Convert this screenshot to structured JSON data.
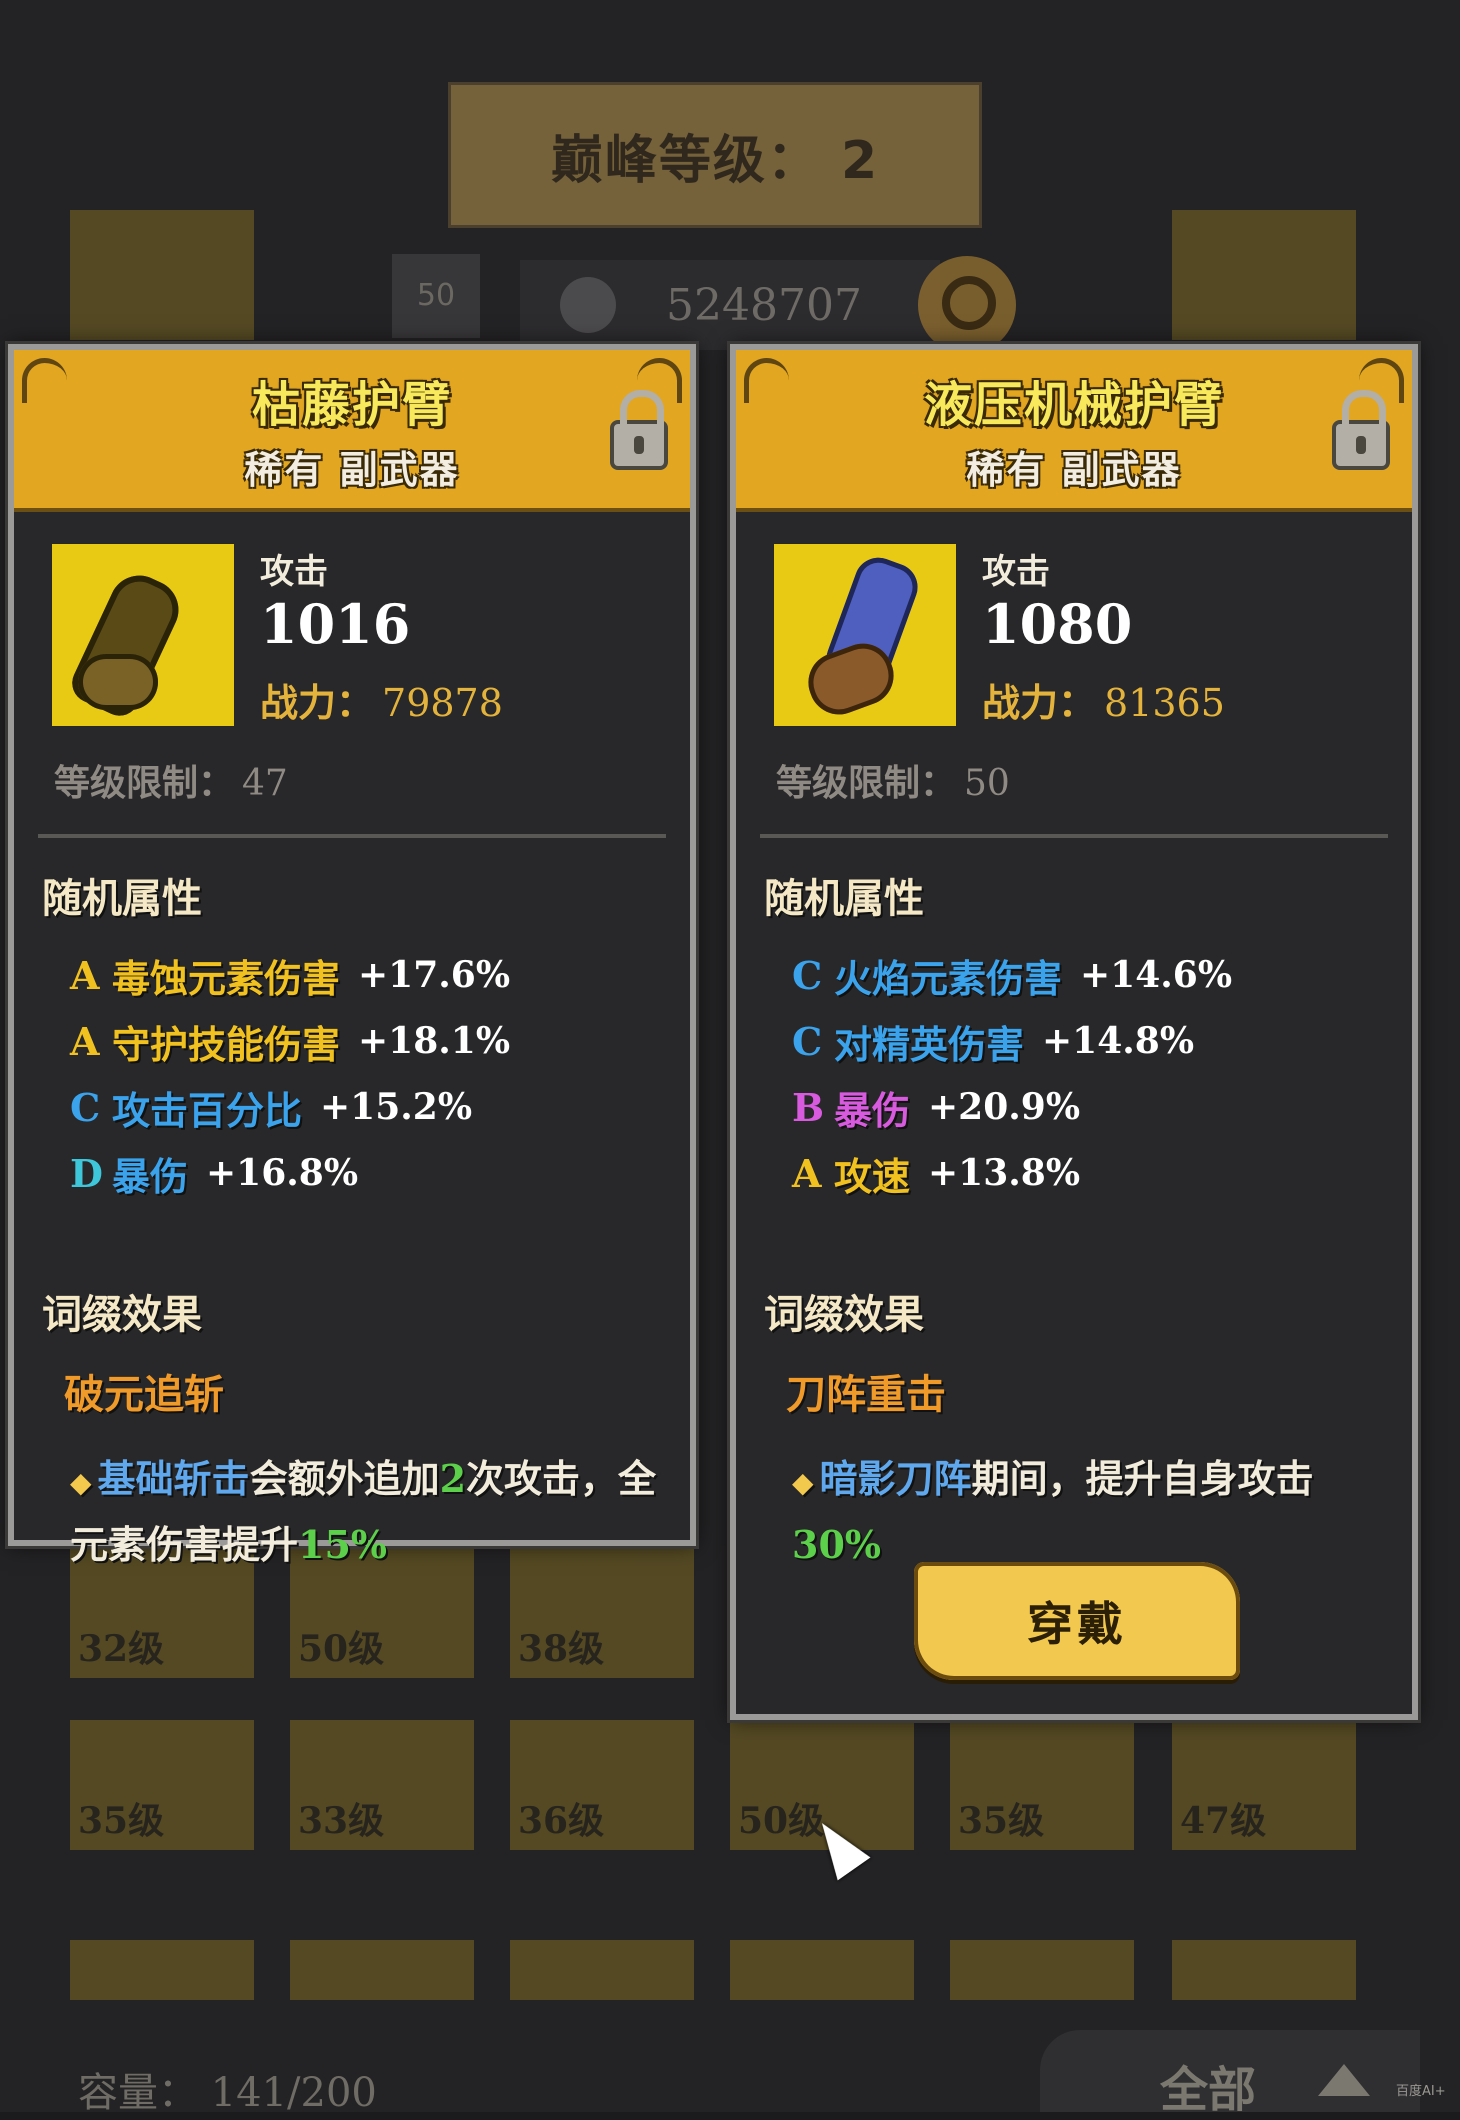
{
  "background": {
    "banner_label": "巅峰等级： 2",
    "level_badge": "50",
    "power_total": "5248707",
    "slot_levels": [
      "32级",
      "50级",
      "38级",
      "35级",
      "33级",
      "36级",
      "50级",
      "35级",
      "47级"
    ],
    "capacity": "容量： 141/200",
    "filter_label": "全部",
    "watermark": "百度AI+"
  },
  "cards": [
    {
      "name": "枯藤护臂",
      "subtitle": "稀有 副武器",
      "stat_label": "攻击",
      "stat_value": "1016",
      "power_label": "战力：",
      "power_value": "79878",
      "level_req_label": "等级限制：",
      "level_req_value": "47",
      "random_attr_title": "随机属性",
      "attrs": [
        {
          "grade": "A",
          "name": "毒蚀元素伤害",
          "value": "+17.6%"
        },
        {
          "grade": "A",
          "name": "守护技能伤害",
          "value": "+18.1%"
        },
        {
          "grade": "C",
          "name": "攻击百分比",
          "value": "+15.2%"
        },
        {
          "grade": "D",
          "name": "暴伤",
          "value": "+16.8%"
        }
      ],
      "affix_title": "词缀效果",
      "affix_name": "破元追斩",
      "affix_skill": "基础斩击",
      "affix_text1": "会额外追加",
      "affix_num1": "2",
      "affix_text2": "次攻击，全元素伤害提升",
      "affix_num2": "15%"
    },
    {
      "name": "液压机械护臂",
      "subtitle": "稀有 副武器",
      "stat_label": "攻击",
      "stat_value": "1080",
      "power_label": "战力：",
      "power_value": "81365",
      "level_req_label": "等级限制：",
      "level_req_value": "50",
      "random_attr_title": "随机属性",
      "attrs": [
        {
          "grade": "C",
          "name": "火焰元素伤害",
          "value": "+14.6%"
        },
        {
          "grade": "C",
          "name": "对精英伤害",
          "value": "+14.8%"
        },
        {
          "grade": "B",
          "name": "暴伤",
          "value": "+20.9%"
        },
        {
          "grade": "A",
          "name": "攻速",
          "value": "+13.8%"
        }
      ],
      "affix_title": "词缀效果",
      "affix_name": "刀阵重击",
      "affix_skill": "暗影刀阵",
      "affix_text1": "期间，提升自身攻击",
      "affix_num1": "30%",
      "wear_button": "穿戴"
    }
  ],
  "colors": {
    "header_gold": "#e2a621",
    "grade_A": "#f1c21f",
    "grade_B": "#d75adf",
    "grade_C": "#3aa3ec",
    "grade_D": "#3ec7da",
    "affix_orange": "#f09a2a",
    "highlight_green": "#5cd04b"
  },
  "icons": [
    "lock-icon",
    "fist-icon",
    "magnifier-icon",
    "cursor-icon",
    "diamond-bullet-icon"
  ]
}
